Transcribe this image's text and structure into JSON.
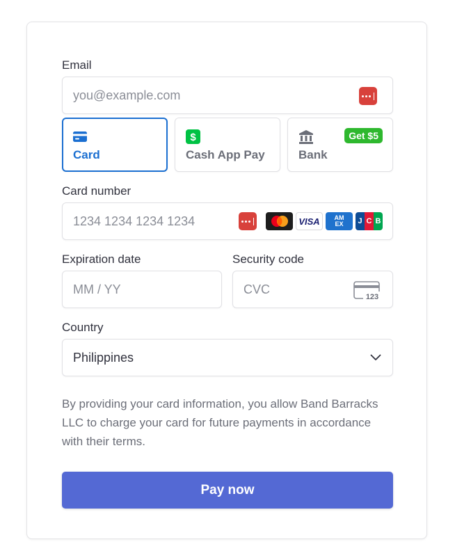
{
  "email": {
    "label": "Email",
    "placeholder": "you@example.com",
    "autofill_icon": "password-manager-icon"
  },
  "payment_methods": [
    {
      "label": "Card",
      "icon": "credit-card-icon",
      "selected": true
    },
    {
      "label": "Cash App Pay",
      "icon": "cash-app-icon",
      "selected": false
    },
    {
      "label": "Bank",
      "icon": "bank-icon",
      "selected": false,
      "badge": "Get $5"
    }
  ],
  "card_number": {
    "label": "Card number",
    "placeholder": "1234 1234 1234 1234",
    "brands": [
      "mastercard",
      "visa",
      "amex",
      "jcb"
    ],
    "brand_text": {
      "visa": "VISA",
      "amex_top": "AM",
      "amex_bottom": "EX",
      "jcb": [
        "J",
        "C",
        "B"
      ]
    }
  },
  "expiration": {
    "label": "Expiration date",
    "placeholder": "MM / YY"
  },
  "security": {
    "label": "Security code",
    "placeholder": "CVC",
    "icon_text": "123"
  },
  "country": {
    "label": "Country",
    "value": "Philippines"
  },
  "consent": "By providing your card information, you allow Band Barracks LLC to charge your card for future payments in accordance with their terms.",
  "pay_button": "Pay now",
  "colors": {
    "accent": "#1b6fd1",
    "button": "#5469d4",
    "promo": "#2eb82e",
    "cashapp": "#00c244"
  }
}
